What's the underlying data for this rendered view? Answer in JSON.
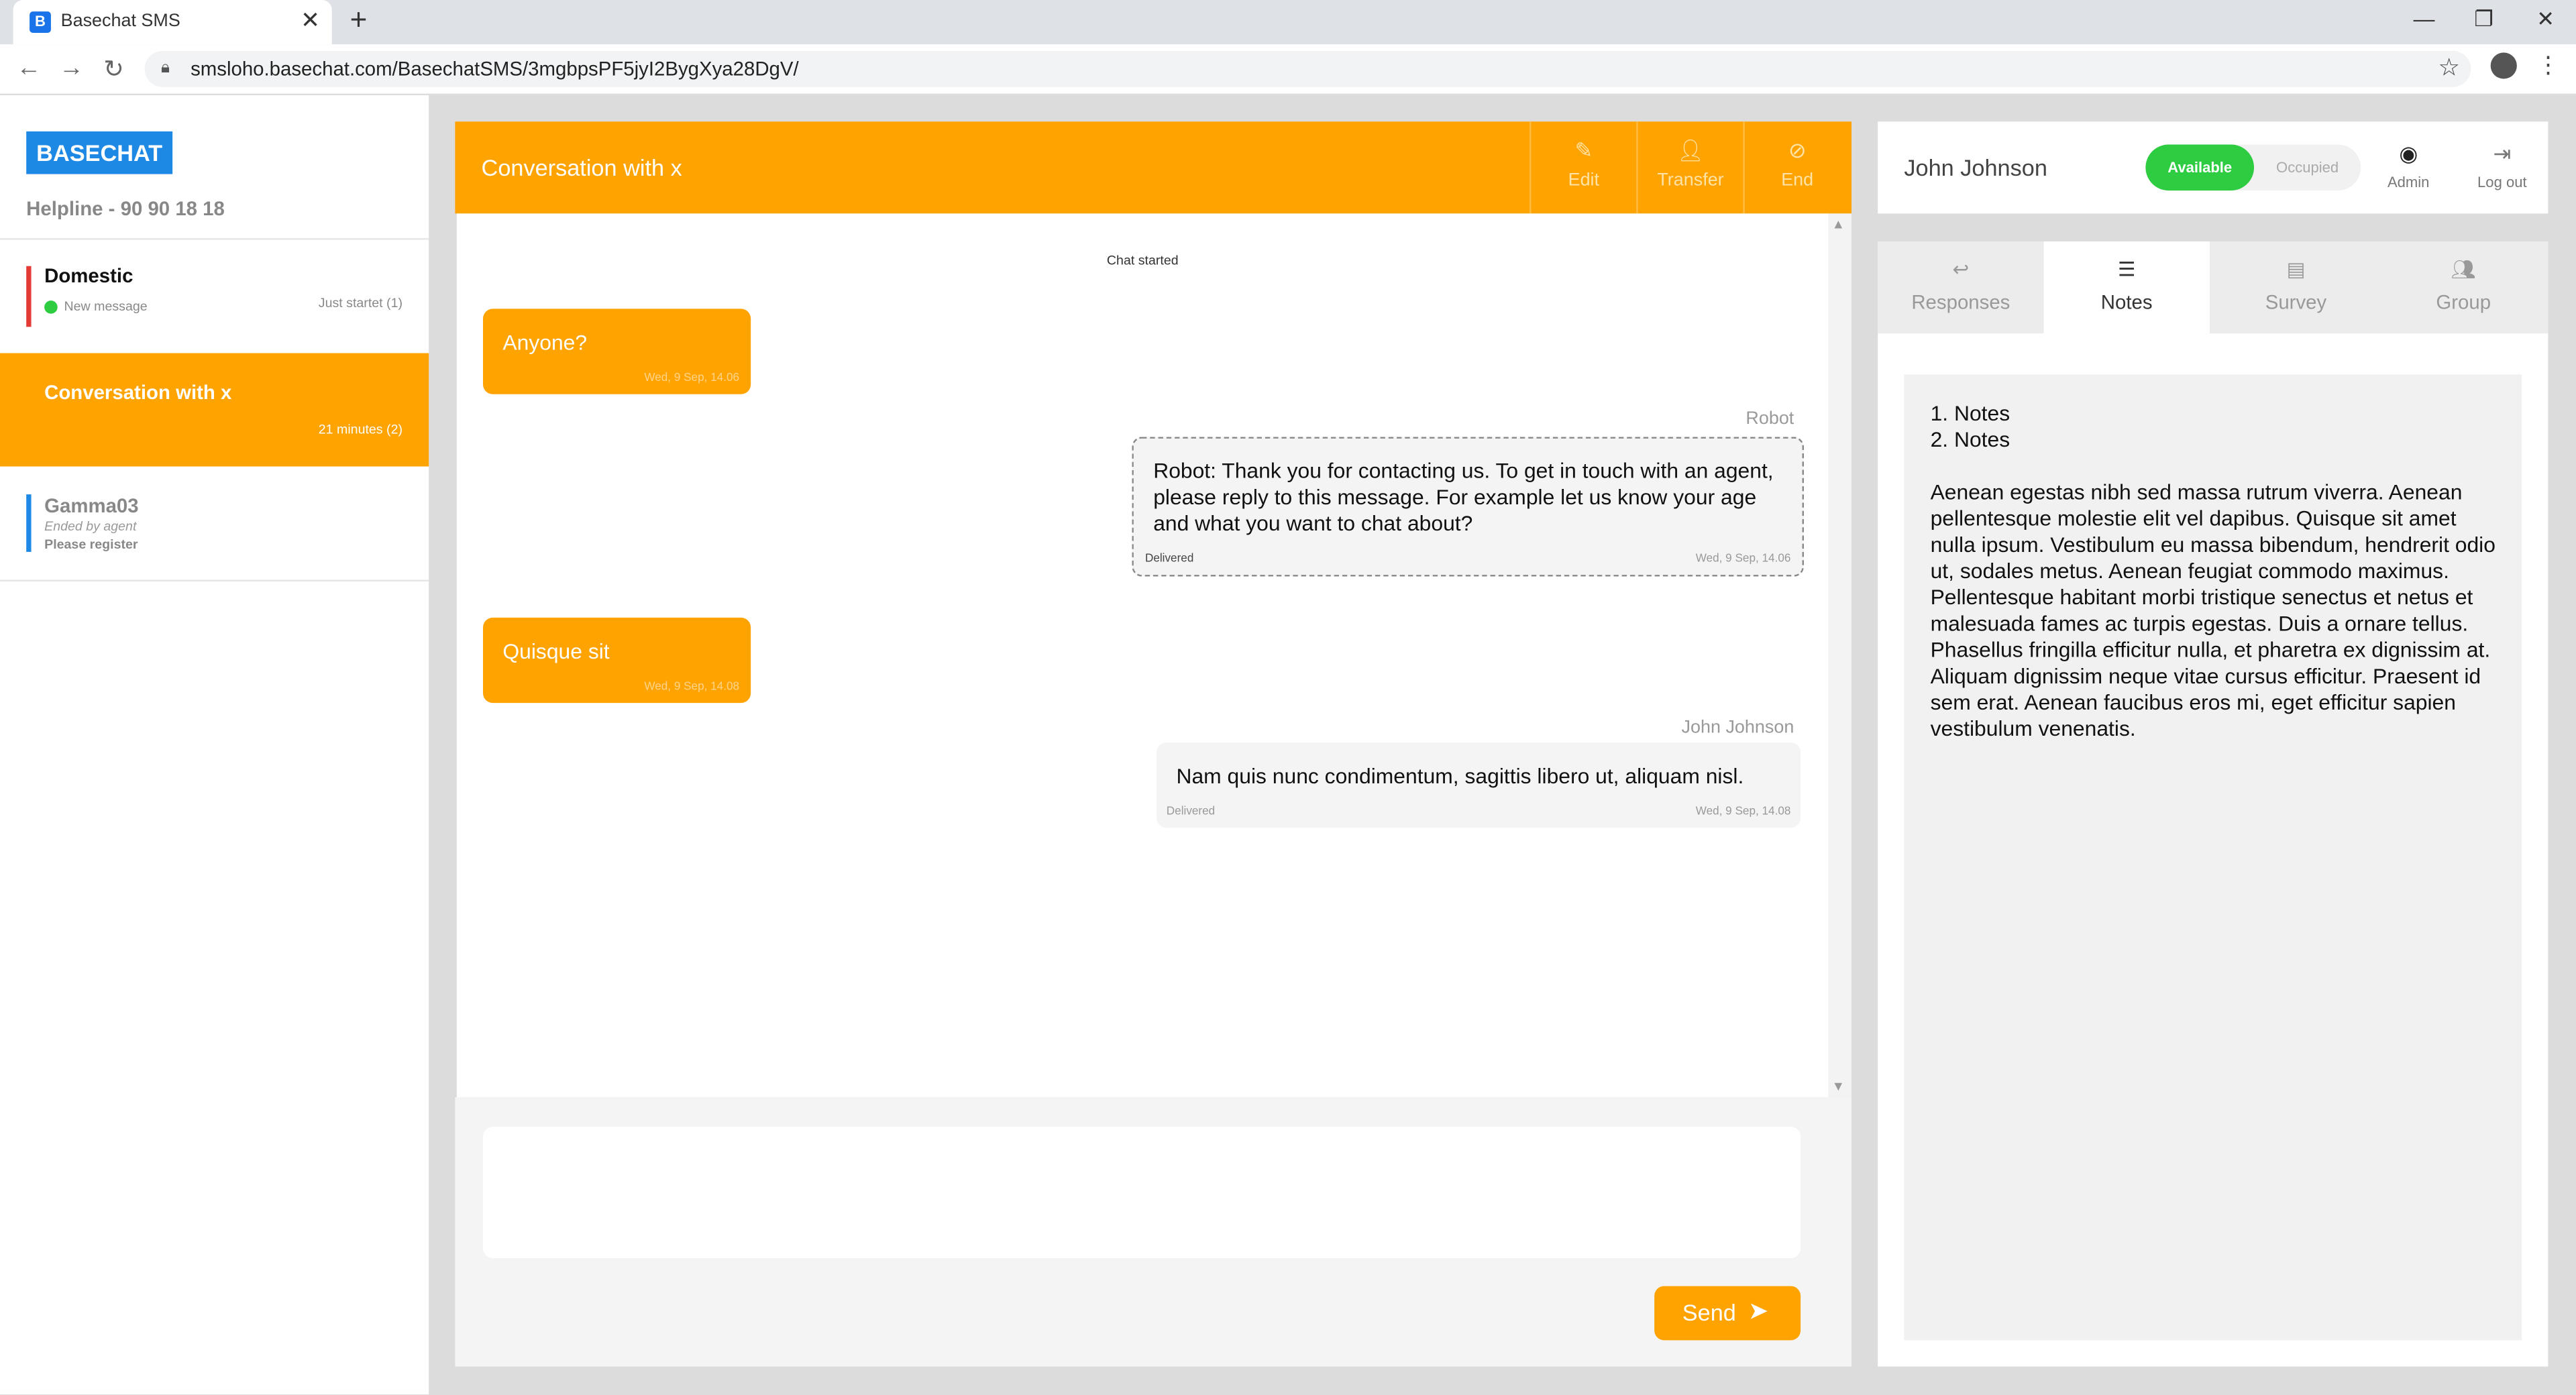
{
  "browser": {
    "tab_title": "Basechat SMS",
    "favicon_letter": "B",
    "url": "smsloho.basechat.com/BasechatSMS/3mgbpsPF5jyI2BygXya28DgV/"
  },
  "sidebar": {
    "logo": "BASECHAT",
    "helpline": "Helpline - 90 90 18 18",
    "conversations": [
      {
        "name": "Domestic",
        "status": "New message",
        "time": "Just startet (1)",
        "bar_color": "#e53935"
      },
      {
        "name": "Conversation with x",
        "time": "21 minutes (2)"
      },
      {
        "name": "Gamma03",
        "sub": "Ended by agent",
        "sub2": "Please register",
        "bar_color": "#1e88e5"
      }
    ]
  },
  "header": {
    "title": "Conversation with x",
    "buttons": [
      {
        "label": "Edit",
        "icon": "pencil-icon"
      },
      {
        "label": "Transfer",
        "icon": "person-icon"
      },
      {
        "label": "End",
        "icon": "block-icon"
      }
    ]
  },
  "chat": {
    "started": "Chat started",
    "messages": [
      {
        "text": "Anyone?",
        "date": "Wed, 9 Sep, 14.06"
      },
      {
        "sender": "Robot",
        "text": "Robot: Thank you for contacting us. To get in touch with an agent, please reply to this message. For example let us know your age and what you want to chat about?",
        "status": "Delivered",
        "date": "Wed, 9 Sep, 14.06"
      },
      {
        "text": "Quisque sit",
        "date": "Wed, 9 Sep, 14.08"
      },
      {
        "sender": "John Johnson",
        "text": "Nam quis nunc condimentum, sagittis libero ut, aliquam nisl.",
        "status": "Delivered",
        "date": "Wed, 9 Sep, 14.08"
      }
    ]
  },
  "composer": {
    "send_label": "Send"
  },
  "topbar": {
    "agent": "John Johnson",
    "available": "Available",
    "occupied": "Occupied",
    "admin": "Admin",
    "logout": "Log out"
  },
  "tabs": [
    "Responses",
    "Notes",
    "Survey",
    "Group"
  ],
  "notes": {
    "items": [
      "1. Notes",
      "2. Notes"
    ],
    "body": "Aenean egestas nibh sed massa rutrum viverra. Aenean pellentesque molestie elit vel dapibus. Quisque sit amet nulla ipsum. Vestibulum eu massa bibendum, hendrerit odio ut, sodales metus. Aenean feugiat commodo maximus. Pellentesque habitant morbi tristique senectus et netus et malesuada fames ac turpis egestas. Duis a ornare tellus. Phasellus fringilla efficitur nulla, et pharetra ex dignissim at. Aliquam dignissim neque vitae cursus efficitur. Praesent id sem erat. Aenean faucibus eros mi, eget efficitur sapien vestibulum venenatis."
  },
  "colors": {
    "accent": "#ffa300",
    "available": "#2ecc40",
    "logo": "#1e88e5"
  }
}
